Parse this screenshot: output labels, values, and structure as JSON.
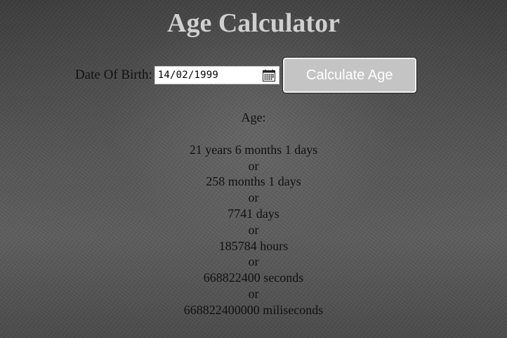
{
  "page": {
    "title": "Age Calculator"
  },
  "form": {
    "dob_label": "Date Of Birth:",
    "dob_value": "14/02/1999",
    "calendar_icon": "calendar-icon",
    "button_label": "Calculate Age"
  },
  "result": {
    "heading": "Age:",
    "years_months_days": "21 years 6 months 1 days",
    "months_days": "258 months 1 days",
    "days": "7741 days",
    "hours": "185784 hours",
    "seconds": "668822400 seconds",
    "milliseconds": "668822400000 miliseconds",
    "separator": "or"
  },
  "colors": {
    "title": "#cfcfcf",
    "button_bg": "#c4c4c4",
    "button_text": "#ffffff",
    "text": "#111111"
  }
}
